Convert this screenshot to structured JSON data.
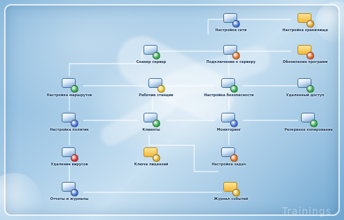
{
  "colors": {
    "line": "#ffffff",
    "text": "#0e2f52"
  },
  "nodes": [
    {
      "id": "n1",
      "label": "Настройка сети",
      "icon": "network-settings-icon",
      "badge": "#3f6fd6",
      "folder": false
    },
    {
      "id": "n2",
      "label": "Настройка хранилища",
      "icon": "storage-settings-icon",
      "badge": "#e0a020",
      "folder": true
    },
    {
      "id": "n3",
      "label": "Сканер сервер",
      "icon": "scanner-server-icon",
      "badge": "#2fa84a",
      "folder": false
    },
    {
      "id": "n4",
      "label": "Подключение к серверу",
      "icon": "server-connect-icon",
      "badge": "#e07020",
      "folder": false
    },
    {
      "id": "n5",
      "label": "Обновления программ",
      "icon": "software-updates-icon",
      "badge": "#e05a20",
      "folder": true
    },
    {
      "id": "n6",
      "label": "Настройка маршрутов",
      "icon": "route-settings-icon",
      "badge": "#2fa84a",
      "folder": false
    },
    {
      "id": "n7",
      "label": "Рабочие станции",
      "icon": "workstations-icon",
      "badge": "#f0c020",
      "folder": false
    },
    {
      "id": "n8",
      "label": "Настройка безопасности",
      "icon": "security-settings-icon",
      "badge": "#2fa84a",
      "folder": false
    },
    {
      "id": "n9",
      "label": "Удаленный доступ",
      "icon": "remote-access-icon",
      "badge": "#2fa84a",
      "folder": false
    },
    {
      "id": "n10",
      "label": "Настройка политик",
      "icon": "policy-settings-icon",
      "badge": "#3f6fd6",
      "folder": false
    },
    {
      "id": "n11",
      "label": "Клиенты",
      "icon": "clients-icon",
      "badge": "#2fa84a",
      "folder": false
    },
    {
      "id": "n12",
      "label": "Мониторинг",
      "icon": "monitoring-icon",
      "badge": "#3f6fd6",
      "folder": false
    },
    {
      "id": "n13",
      "label": "Резервное копирование",
      "icon": "backup-icon",
      "badge": "#2fa84a",
      "folder": false
    },
    {
      "id": "n14",
      "label": "Удаление вирусов",
      "icon": "virus-removal-icon",
      "badge": "#d83030",
      "folder": false
    },
    {
      "id": "n15",
      "label": "Ключи лицензий",
      "icon": "license-keys-icon",
      "badge": "#e0b020",
      "folder": true
    },
    {
      "id": "n16",
      "label": "Настройка задач",
      "icon": "tasks-settings-icon",
      "badge": "#e07020",
      "folder": false
    },
    {
      "id": "n17",
      "label": "Отчеты и журналы",
      "icon": "reports-icon",
      "badge": "#3f6fd6",
      "folder": false
    },
    {
      "id": "n18",
      "label": "Журнал событий",
      "icon": "event-log-icon",
      "badge": "#e0b020",
      "folder": true
    }
  ],
  "watermark": "Trainings"
}
